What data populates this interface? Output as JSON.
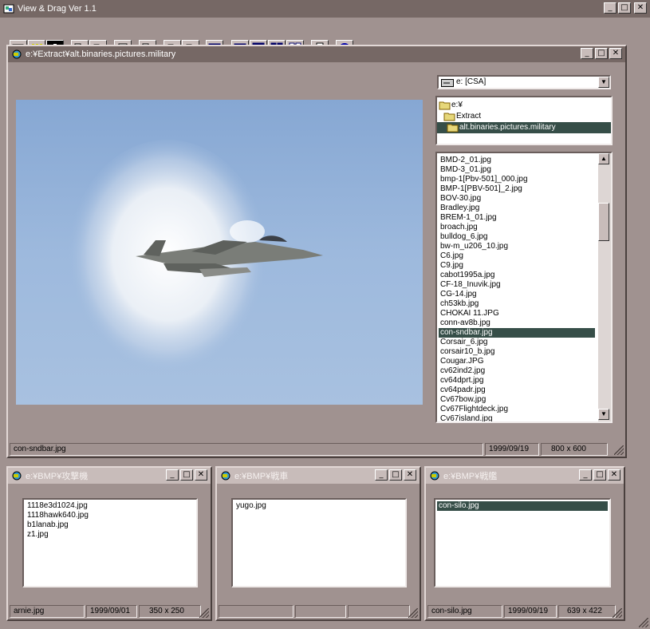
{
  "app": {
    "title": "View & Drag Ver 1.1"
  },
  "toolbar": {
    "icons": [
      "view-icon",
      "grid-icon",
      "film-icon",
      "copy-icon",
      "paste-icon",
      "clear-icon",
      "delete-icon",
      "drag-icon",
      "drag-file-icon",
      "window-icon",
      "tile-horizontal-icon",
      "tile-horizontal2-icon",
      "tile-vertical-icon",
      "tile-grid-icon",
      "print-icon",
      "help-icon"
    ]
  },
  "main_window": {
    "title": "e:¥Extract¥alt.binaries.pictures.military",
    "drive": "e: [CSA]",
    "folders": [
      "e:¥",
      "Extract",
      "alt.binaries.pictures.military"
    ],
    "selected_folder": 2,
    "files": [
      "BMD-2_01.jpg",
      "BMD-3_01.jpg",
      "bmp-1[Pbv-501]_000.jpg",
      "BMP-1[PBV-501]_2.jpg",
      "BOV-30.jpg",
      "Bradley.jpg",
      "BREM-1_01.jpg",
      "broach.jpg",
      "bulldog_6.jpg",
      "bw-m_u206_10.jpg",
      "C6.jpg",
      "C9.jpg",
      "cabot1995a.jpg",
      "CF-18_Inuvik.jpg",
      "CG-14.jpg",
      "ch53kb.jpg",
      "CHOKAI 11.JPG",
      "conn-av8b.jpg",
      "con-sndbar.jpg",
      "Corsair_6.jpg",
      "corsair10_b.jpg",
      "Cougar.JPG",
      "cv62ind2.jpg",
      "cv64dprt.jpg",
      "cv64padr.jpg",
      "Cv67bow.jpg",
      "Cv67Flightdeck.jpg",
      "Cv67island.jpg"
    ],
    "selected_file_index": 18,
    "status": {
      "filename": "con-sndbar.jpg",
      "date": "1999/09/19",
      "size": "800 x 600"
    }
  },
  "sub_windows": [
    {
      "title": "e:¥BMP¥攻撃機",
      "files": [
        "1118e3d1024.jpg",
        "1118hawk640.jpg",
        "b1lanab.jpg",
        "z1.jpg"
      ],
      "selected": -1,
      "status": {
        "filename": "arnie.jpg",
        "date": "1999/09/01",
        "size": "350 x 250"
      }
    },
    {
      "title": "e:¥BMP¥戦車",
      "files": [
        "yugo.jpg"
      ],
      "selected": -1,
      "status": {
        "filename": "",
        "date": "",
        "size": ""
      }
    },
    {
      "title": "e:¥BMP¥戦艦",
      "files": [
        "con-silo.jpg"
      ],
      "selected": 0,
      "status": {
        "filename": "con-silo.jpg",
        "date": "1999/09/19",
        "size": "639 x 422"
      }
    }
  ],
  "window_controls": {
    "minimize": "_",
    "maximize": "□",
    "close": "✕"
  }
}
